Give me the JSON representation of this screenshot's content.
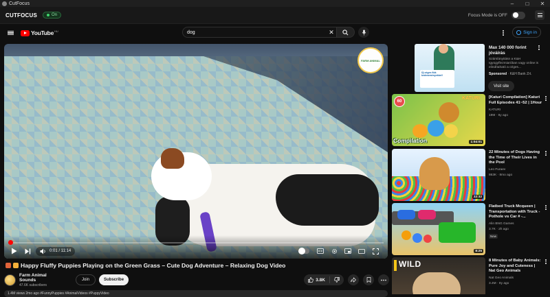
{
  "window": {
    "title": "CutFocus"
  },
  "cutfocus": {
    "logo": "CUTFOCUS",
    "badge": "On",
    "focus_mode": "Focus Mode is OFF"
  },
  "youtube": {
    "logo": "YouTube",
    "country": "HU",
    "search": {
      "value": "dog"
    },
    "signin": "Sign in"
  },
  "player": {
    "time_current": "0:01",
    "time_total": "11:14",
    "time_display": "0:01 / 11:14",
    "progress_fraction": 0.0015,
    "channel_bug": "FARM ANIMAL"
  },
  "video": {
    "title": "Happy Fluffy Puppies Playing on the Green Grass – Cute Dog Adventure – Relaxing Dog Video",
    "channel": "Farm Animal Sounds",
    "subscribers": "47.6K subscribers",
    "join": "Join",
    "subscribe": "Subscribe",
    "likes": "3.8K"
  },
  "sidebar": {
    "ad": {
      "title": "Max 140 000 forint jóváírás",
      "text": "Számlányitásn a K&H Igyügyflezmiaróban vagy online is elindítaható a céges...",
      "sponsored": "Sponsored",
      "advertiser": "K&H Bank Zrt.",
      "card_text": "Új céges fiók kedvezményekkel!",
      "visit": "Visit site"
    },
    "recs": [
      {
        "title": "[Katuri Compilation] Katuri Full Episodes 41~52 | 1Hour",
        "channel": "KATURI",
        "meta": "19M · 6y ago",
        "duration": "1:04:01",
        "thumb_words": [
          "60",
          "KATURI",
          "Compilation"
        ]
      },
      {
        "title": "22 Minutes of Dogs Having the Time of Their Lives in the Pool",
        "channel": "Leo Furaev",
        "meta": "863K · 8mo ago",
        "duration": "22:32"
      },
      {
        "title": "Flatbed Truck Mcqueen | Transportation with Truck - Pothole vs Car # -...",
        "channel": "Alin BNG Games",
        "meta": "3.7K · 2h ago",
        "badge": "New",
        "duration": "8:25"
      },
      {
        "title": "8 Minutes of Baby Animals: Pure Joy and Cuteness | Nat Geo Animals",
        "channel": "Nat Geo Animals",
        "meta": "3.4M · 8y ago",
        "thumb_words": [
          "WILD"
        ]
      }
    ]
  },
  "description_peek": "1.4M views  2mo ago  #FunnyPuppies #AnimalVideos #PuppyVideo"
}
